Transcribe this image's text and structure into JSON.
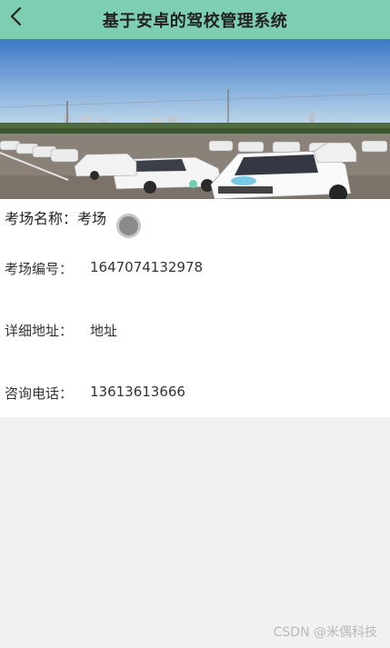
{
  "header": {
    "title": "基于安卓的驾校管理系统",
    "back_icon": "chevron-left-icon",
    "background": "#7ecfb2"
  },
  "banner": {
    "active_indicator_color": "#6fcdb0"
  },
  "venue": {
    "name_label": "考场名称：",
    "name_value": "考场",
    "fields": [
      {
        "label": "考场编号：",
        "value": "1647074132978"
      },
      {
        "label": "详细地址：",
        "value": "地址"
      },
      {
        "label": "咨询电话：",
        "value": "13613613666"
      }
    ]
  },
  "watermark": "CSDN @米偶科技"
}
